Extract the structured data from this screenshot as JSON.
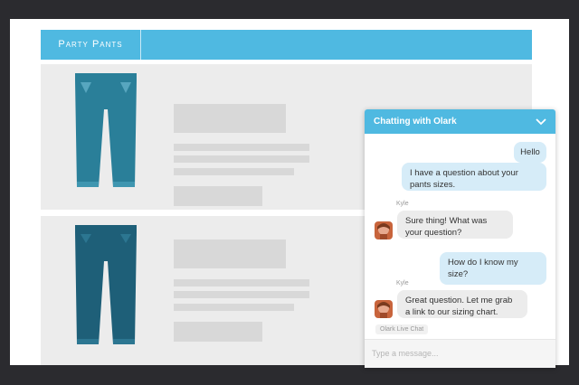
{
  "site": {
    "brand": "Party Pants"
  },
  "chat": {
    "title": "Chatting with Olark",
    "messages": [
      {
        "from": "visitor",
        "text": "Hello"
      },
      {
        "from": "visitor",
        "text": "I have a question about your pants sizes."
      },
      {
        "from": "agent",
        "author": "Kyle",
        "text": "Sure thing! What was your question?"
      },
      {
        "from": "visitor",
        "text": "How do I know my size?"
      },
      {
        "from": "agent",
        "author": "Kyle",
        "text": "Great question. Let me grab a link to our sizing chart."
      }
    ],
    "badge": "Olark Live Chat",
    "composer_placeholder": "Type a message..."
  },
  "colors": {
    "accent": "#4fb9e1",
    "pants_light": "#2a7f99",
    "pants_dark": "#1e5f78"
  }
}
